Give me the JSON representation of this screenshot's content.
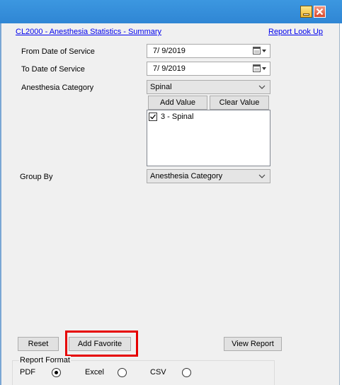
{
  "report": {
    "title_link": "CL2000 - Anesthesia Statistics - Summary",
    "lookup_link": "Report Look Up"
  },
  "fields": {
    "from_date": {
      "label": "From Date of Service",
      "value": "7/ 9/2019"
    },
    "to_date": {
      "label": "To Date of Service",
      "value": "7/ 9/2019"
    },
    "anesthesia_category": {
      "label": "Anesthesia Category",
      "selected": "Spinal",
      "add_value_label": "Add Value",
      "clear_value_label": "Clear Value",
      "list_items": [
        {
          "label": "3 - Spinal",
          "checked": true
        }
      ]
    },
    "group_by": {
      "label": "Group By",
      "selected": "Anesthesia Category"
    }
  },
  "buttons": {
    "reset": "Reset",
    "add_favorite": "Add Favorite",
    "view_report": "View Report"
  },
  "report_format": {
    "legend": "Report Format",
    "options": [
      {
        "label": "PDF",
        "selected": true
      },
      {
        "label": "Excel",
        "selected": false
      },
      {
        "label": "CSV",
        "selected": false
      }
    ]
  },
  "colors": {
    "titlebar": "#2f86d4",
    "panel": "#f0f0f0",
    "link": "#0000ee",
    "highlight": "#e60000"
  }
}
